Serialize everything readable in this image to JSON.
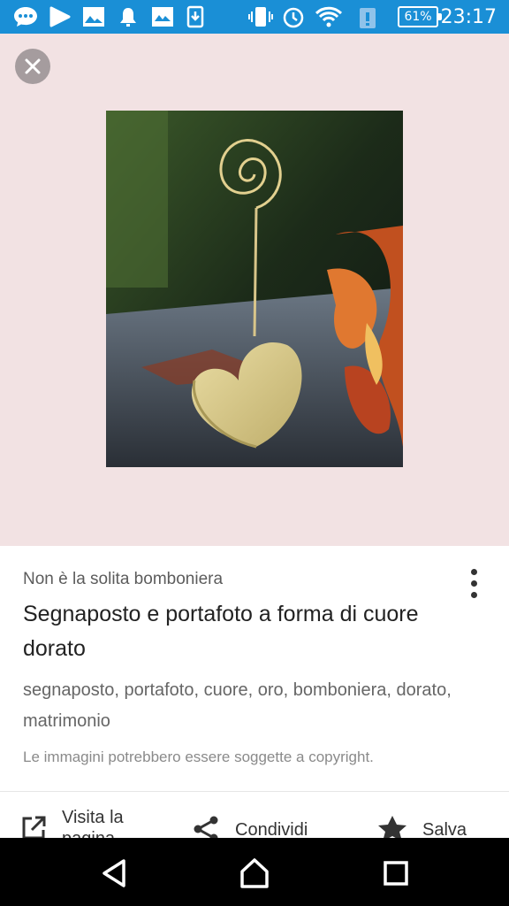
{
  "status_bar": {
    "time": "23:17",
    "battery": "61%",
    "icons": [
      "messenger-icon",
      "play-store-icon",
      "gallery-icon",
      "bell-icon",
      "news-icon",
      "download-icon",
      "vibrate-icon",
      "alarm-icon",
      "wifi-icon",
      "battery-alert-icon"
    ],
    "background": "#1a8fd6"
  },
  "close_icon": "close-icon",
  "image": {
    "subject": "golden heart-shaped place card holder"
  },
  "card": {
    "source": "Non è la solita bomboniera",
    "title": "Segnaposto e portafoto a forma di cuore dorato",
    "tags": "segnaposto, portafoto, cuore, oro, bomboniera, dorato, matrimonio",
    "copyright": "Le immagini potrebbero essere soggette a copyright.",
    "actions": {
      "visit": "Visita la pagina",
      "share": "Condividi",
      "save": "Salva"
    }
  },
  "nav": {
    "back_icon": "back-icon",
    "home_icon": "home-icon",
    "recents_icon": "recents-icon"
  }
}
